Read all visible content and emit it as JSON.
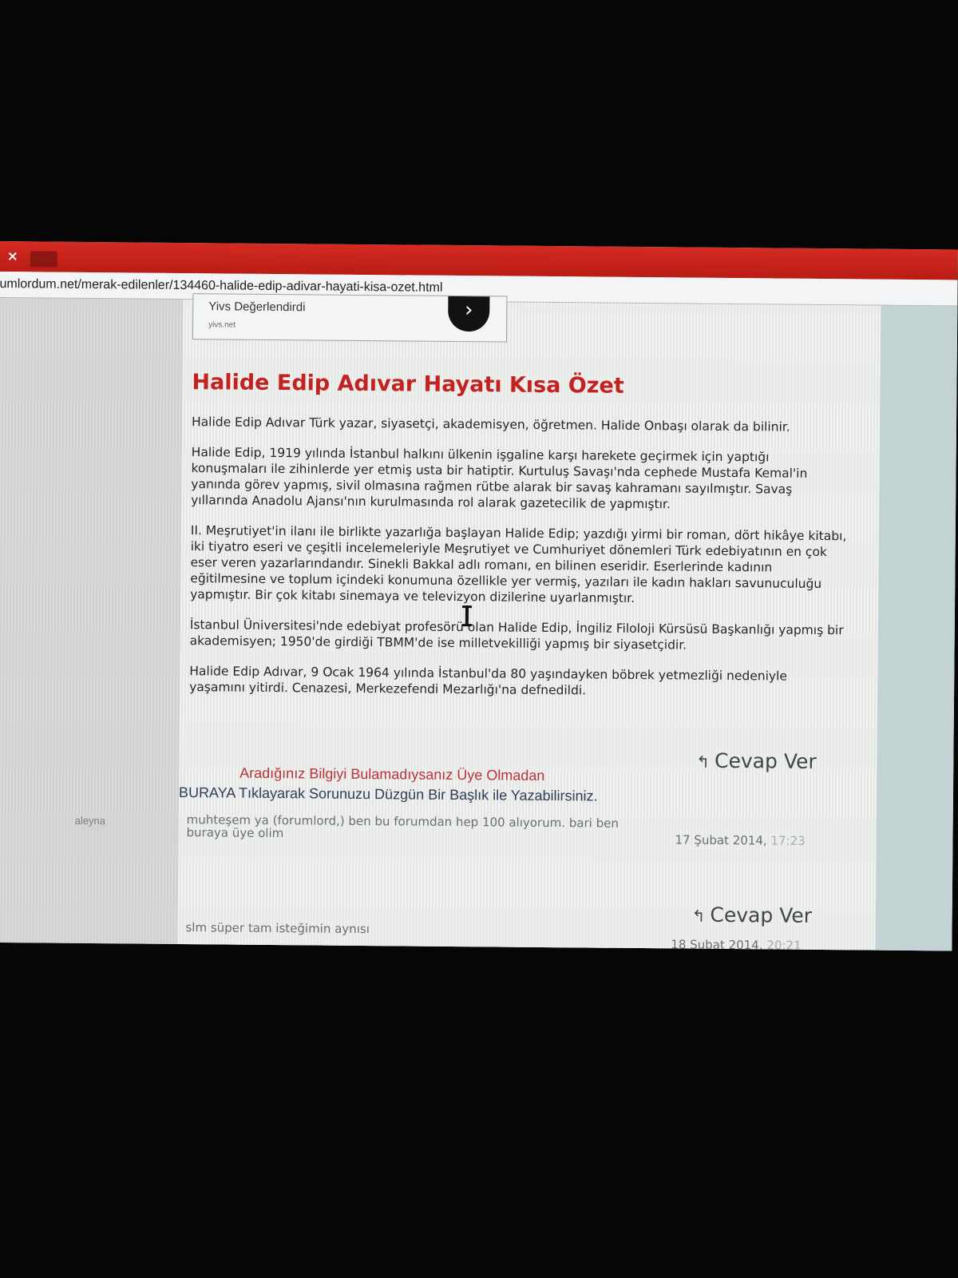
{
  "browser": {
    "tab_close_glyph": "×",
    "url": "umlordum.net/merak-edilenler/134460-halide-edip-adivar-hayati-kisa-ozet.html"
  },
  "ad": {
    "title": "Yivs Değerlendirdi",
    "domain": "yivs.net",
    "arrow_glyph": "›"
  },
  "article": {
    "title": "Halide Edip Adıvar Hayatı Kısa Özet",
    "paragraphs": [
      "Halide Edip Adıvar Türk yazar, siyasetçi, akademisyen, öğretmen. Halide Onbaşı olarak da bilinir.",
      "Halide Edip, 1919 yılında İstanbul halkını ülkenin işgaline karşı harekete geçirmek için yaptığı konuşmaları ile zihinlerde yer etmiş usta bir hatiptir. Kurtuluş Savaşı'nda cephede Mustafa Kemal'in yanında görev yapmış, sivil olmasına rağmen rütbe alarak bir savaş kahramanı sayılmıştır. Savaş yıllarında Anadolu Ajansı'nın kurulmasında rol alarak gazetecilik de yapmıştır.",
      "II. Meşrutiyet'in ilanı ile birlikte yazarlığa başlayan Halide Edip; yazdığı yirmi bir roman, dört hikâye kitabı, iki tiyatro eseri ve çeşitli incelemeleriyle Meşrutiyet ve Cumhuriyet dönemleri Türk edebiyatının en çok eser veren yazarlarındandır. Sinekli Bakkal adlı romanı, en bilinen eseridir. Eserlerinde kadının eğitilmesine ve toplum içindeki konumuna özellikle yer vermiş, yazıları ile kadın hakları savunuculuğu yapmıştır. Bir çok kitabı sinemaya ve televizyon dizilerine uyarlanmıştır.",
      "İstanbul Üniversitesi'nde edebiyat profesörü olan Halide Edip, İngiliz Filoloji Kürsüsü Başkanlığı yapmış bir akademisyen; 1950'de girdiği TBMM'de ise milletvekilliği yapmış bir siyasetçidir.",
      "Halide Edip Adıvar, 9 Ocak 1964 yılında İstanbul'da 80 yaşındayken böbrek yetmezliği nedeniyle yaşamını yitirdi. Cenazesi, Merkezefendi Mezarlığı'na defnedildi."
    ]
  },
  "reply_button": {
    "icon_glyph": "↰",
    "label": "Cevap Ver"
  },
  "notice": {
    "line1": "Aradığınız Bilgiyi Bulamadıysanız Üye Olmadan",
    "line2": "BURAYA Tıklayarak Sorunuzu Düzgün Bir Başlık ile Yazabilirsiniz."
  },
  "posts": [
    {
      "author": "aleyna",
      "text": "muhteşem ya (forumlord,) ben bu forumdan hep 100 alıyorum. bari ben buraya üye olim",
      "date": "17 Şubat 2014,",
      "time": "17:23"
    },
    {
      "author": "",
      "text": "slm süper tam isteğimin aynısı",
      "date": "18 Şubat 2014,",
      "time": "20:21"
    }
  ]
}
